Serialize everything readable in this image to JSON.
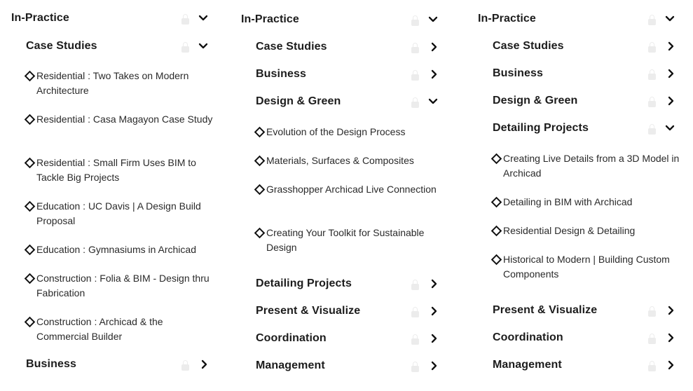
{
  "col1": {
    "title": "In-Practice",
    "case_studies": "Case Studies",
    "lessons": [
      "Residential : Two Takes on Modern Architecture",
      "Residential : Casa Magayon Case Study",
      "Residential : Small Firm Uses BIM to Tackle Big Projects",
      "Education : UC Davis | A Design Build Proposal",
      "Education : Gymnasiums in Archicad",
      "Construction : Folia & BIM - Design thru Fabrication",
      "Construction : Archicad & the Commercial Builder"
    ],
    "business": "Business"
  },
  "col2": {
    "title": "In-Practice",
    "case_studies": "Case Studies",
    "business": "Business",
    "design_green": "Design & Green",
    "lessons": [
      "Evolution of the Design Process",
      "Materials, Surfaces & Composites",
      "Grasshopper Archicad Live Connection",
      "Creating Your Toolkit for Sustainable Design"
    ],
    "detailing": "Detailing Projects",
    "present": "Present & Visualize",
    "coordination": "Coordination",
    "management": "Management"
  },
  "col3": {
    "title": "In-Practice",
    "case_studies": "Case Studies",
    "business": "Business",
    "design_green": "Design & Green",
    "detailing": "Detailing Projects",
    "lessons": [
      "Creating Live Details from a 3D Model in Archicad",
      "Detailing in BIM with Archicad",
      "Residential Design & Detailing",
      "Historical to Modern | Building Custom Components"
    ],
    "present": "Present & Visualize",
    "coordination": "Coordination",
    "management": "Management"
  },
  "icons": [
    "lock-icon",
    "chevron-down-icon",
    "chevron-right-icon",
    "diamond-bullet-icon"
  ]
}
